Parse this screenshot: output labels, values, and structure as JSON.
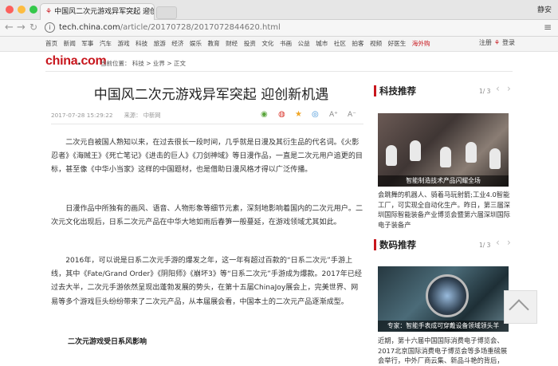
{
  "browser": {
    "tab_title": "中国风二次元游戏异军突起 迎创",
    "user_name": "静安",
    "url_domain": "tech.china.com",
    "url_path": "/article/20170728/2017072844620.html"
  },
  "site_nav": {
    "links": [
      "首页",
      "新闻",
      "军事",
      "汽车",
      "游戏",
      "科技",
      "旅游",
      "经济",
      "娱乐",
      "教育",
      "财经",
      "投资",
      "文化",
      "书画",
      "公益",
      "城市",
      "社区",
      "拍客",
      "视频",
      "好医生"
    ],
    "hot_link": "海外购",
    "login_register": "注册",
    "login_login": "登录"
  },
  "header": {
    "logo_main": "china",
    "logo_dot": ".",
    "logo_tld": "com",
    "breadcrumb": "当前位置： 科技 > 业界 > 正文"
  },
  "article": {
    "title": "中国风二次元游戏异军突起 迎创新机遇",
    "date": "2017-07-28 15:29:22",
    "source": "来源： 中新网",
    "share_icons": [
      "wechat-icon",
      "weibo-icon",
      "star-icon",
      "qq-icon",
      "font-increase-icon",
      "font-decrease-icon"
    ],
    "share_font_plus": "A⁺",
    "share_font_minus": "A⁻",
    "paragraphs": [
      "二次元自被国人熟知以来，在过去很长一段时间，几乎就是日漫及其衍生品的代名词。《火影忍者》《海贼王》《死亡笔记》《进击的巨人》《刀剑神域》等日漫作品，一直是二次元用户追更的目标，甚至像《中华小当家》这样的中国题材，也是借助日漫风格才得以广泛传播。",
      "日漫作品中所独有的画风、语音、人物形象等细节元素，深刻地影响着国内的二次元用户。二次元文化出现后，日系二次元产品在中华大地如雨后春笋一般蔓延，在游戏领域尤其如此。",
      "2016年，可以说是日系二次元手游的爆发之年，这一年有超过百款的“日系二次元”手游上线，其中《Fate/Grand Order》《阴阳师》《崩坏3》等“日系二次元”手游成为爆款。2017年已经过去大半，二次元手游依然呈现出蓬勃发展的势头，在第十五届ChinaJoy展会上，完美世界、网易等多个游戏巨头纷纷带来了二次元产品，从本届展会看，中国本土的二次元产品逐渐成型。"
    ],
    "subheading": "二次元游戏受日系风影响"
  },
  "sidebar": {
    "tech": {
      "heading": "科技推荐",
      "page": "1/ 3",
      "caption": "智能制造技术产品闪耀全场",
      "desc": "会跳舞的机器人、骑着马玩射箭;工业4.0智能工厂，可实现全自动化生产。昨日，第三届深圳国际智能装备产业博览会暨第六届深圳国际电子装备产"
    },
    "digital": {
      "heading": "数码推荐",
      "page": "1/ 3",
      "caption": "专家：智能手表成可穿戴设备领域领头羊",
      "desc": "近期，第十六届中国国际消费电子博览会、2017北京国际消费电子博览会等多场重磅展会举行，中外厂商云集、新品斗艳的背后，"
    },
    "arrow_prev": "‹",
    "arrow_next": "›"
  }
}
